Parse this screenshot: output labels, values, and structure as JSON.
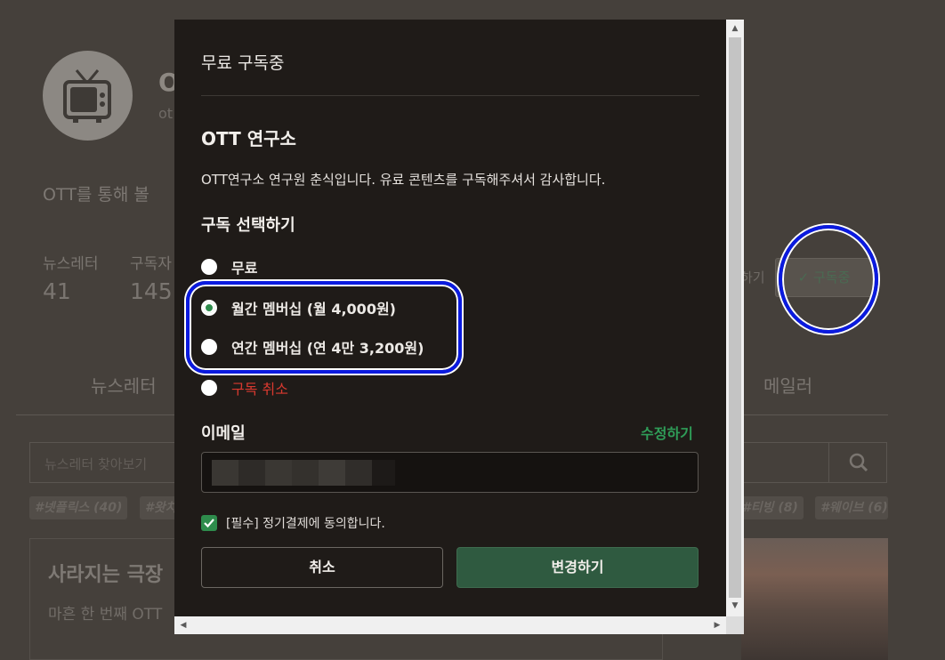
{
  "background": {
    "profile_name": "O",
    "profile_sub": "ot",
    "profile_desc": "OTT를 통해 볼",
    "stats": [
      {
        "label": "뉴스레터",
        "value": "41"
      },
      {
        "label": "구독자",
        "value": "145"
      }
    ],
    "tabs": [
      "뉴스레터",
      "메일러"
    ],
    "search_placeholder": "뉴스레터 찾아보기",
    "tags": [
      "#넷플릭스 (40)",
      "#왓치",
      "#티빙 (8)",
      "#웨이브 (6)"
    ],
    "subscribe_button": "구독중",
    "share_label": "하기",
    "card_title": "사라지는 극장",
    "card_sub": "마흔 한 번째 OTT"
  },
  "modal": {
    "title": "무료 구독중",
    "section_title": "OTT 연구소",
    "description": "OTT연구소 연구원 춘식입니다. 유료 콘텐츠를 구독해주셔서 감사합니다.",
    "choose_label": "구독 선택하기",
    "options": [
      {
        "label": "무료",
        "checked": false
      },
      {
        "label": "월간 멤버십 (월 4,000원)",
        "checked": true
      },
      {
        "label": "연간 멤버십 (연 4만 3,200원)",
        "checked": false
      },
      {
        "label": "구독 취소",
        "checked": false
      }
    ],
    "email_label": "이메일",
    "edit_label": "수정하기",
    "agree_label": "[필수] 정기결제에 동의합니다.",
    "agree_checked": true,
    "cancel_button": "취소",
    "apply_button": "변경하기"
  },
  "colors": {
    "accent_green": "#2f9d58",
    "danger_red": "#d9392f",
    "highlight_blue": "#0a1adf"
  }
}
